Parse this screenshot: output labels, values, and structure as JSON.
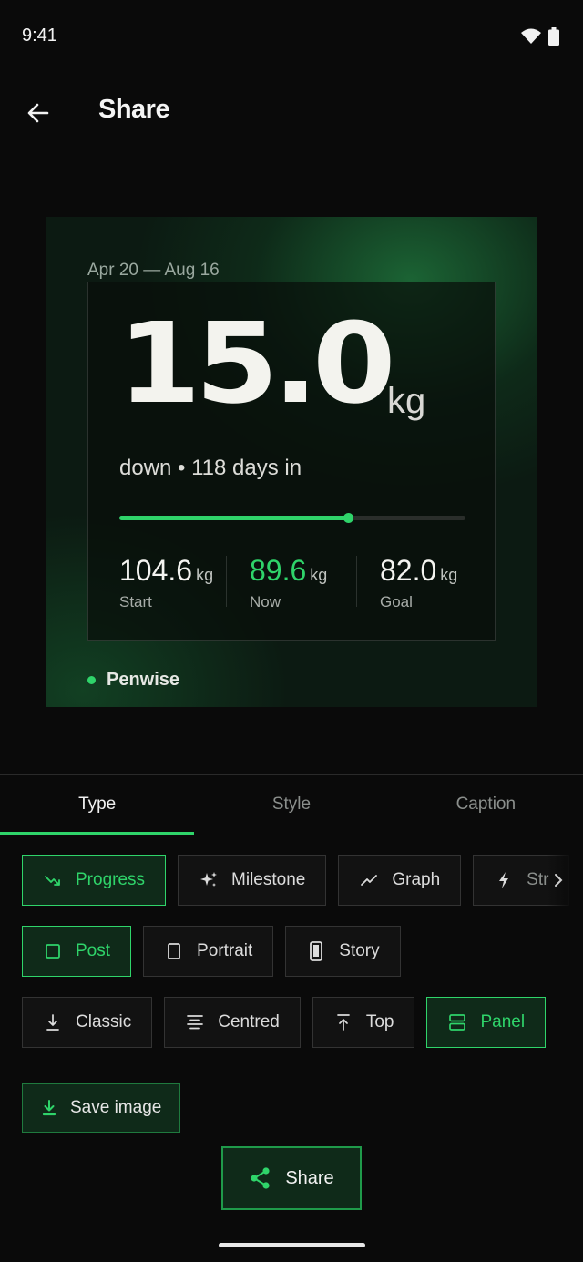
{
  "status": {
    "time": "9:41"
  },
  "header": {
    "title": "Share"
  },
  "card": {
    "date_range": "Apr 20 — Aug 16",
    "amount": "15.0",
    "unit": "kg",
    "subtitle": "down • 118 days in",
    "progress": 0.66,
    "metrics": [
      {
        "value": "104.6",
        "unit": "kg",
        "label": "Start"
      },
      {
        "value": "89.6",
        "unit": "kg",
        "label": "Now"
      },
      {
        "value": "82.0",
        "unit": "kg",
        "label": "Goal"
      }
    ],
    "brand": "Penwise",
    "accent": "#2fd46a"
  },
  "tabs": [
    {
      "label": "Type",
      "active": true
    },
    {
      "label": "Style",
      "active": false
    },
    {
      "label": "Caption",
      "active": false
    }
  ],
  "type_options": [
    {
      "label": "Progress",
      "icon": "trend-down-icon",
      "selected": true
    },
    {
      "label": "Milestone",
      "icon": "sparkle-icon",
      "selected": false
    },
    {
      "label": "Graph",
      "icon": "chart-line-icon",
      "selected": false
    },
    {
      "label": "Str",
      "icon": "bolt-icon",
      "selected": false
    }
  ],
  "format_options": [
    {
      "label": "Post",
      "icon": "square-icon",
      "selected": true
    },
    {
      "label": "Portrait",
      "icon": "portrait-icon",
      "selected": false
    },
    {
      "label": "Story",
      "icon": "phone-icon",
      "selected": false
    }
  ],
  "layout_options": [
    {
      "label": "Classic",
      "icon": "align-bottom-icon",
      "selected": false
    },
    {
      "label": "Centred",
      "icon": "align-center-icon",
      "selected": false
    },
    {
      "label": "Top",
      "icon": "align-top-icon",
      "selected": false
    },
    {
      "label": "Panel",
      "icon": "panel-icon",
      "selected": true
    }
  ],
  "actions": {
    "save_label": "Save image",
    "share_label": "Share"
  }
}
